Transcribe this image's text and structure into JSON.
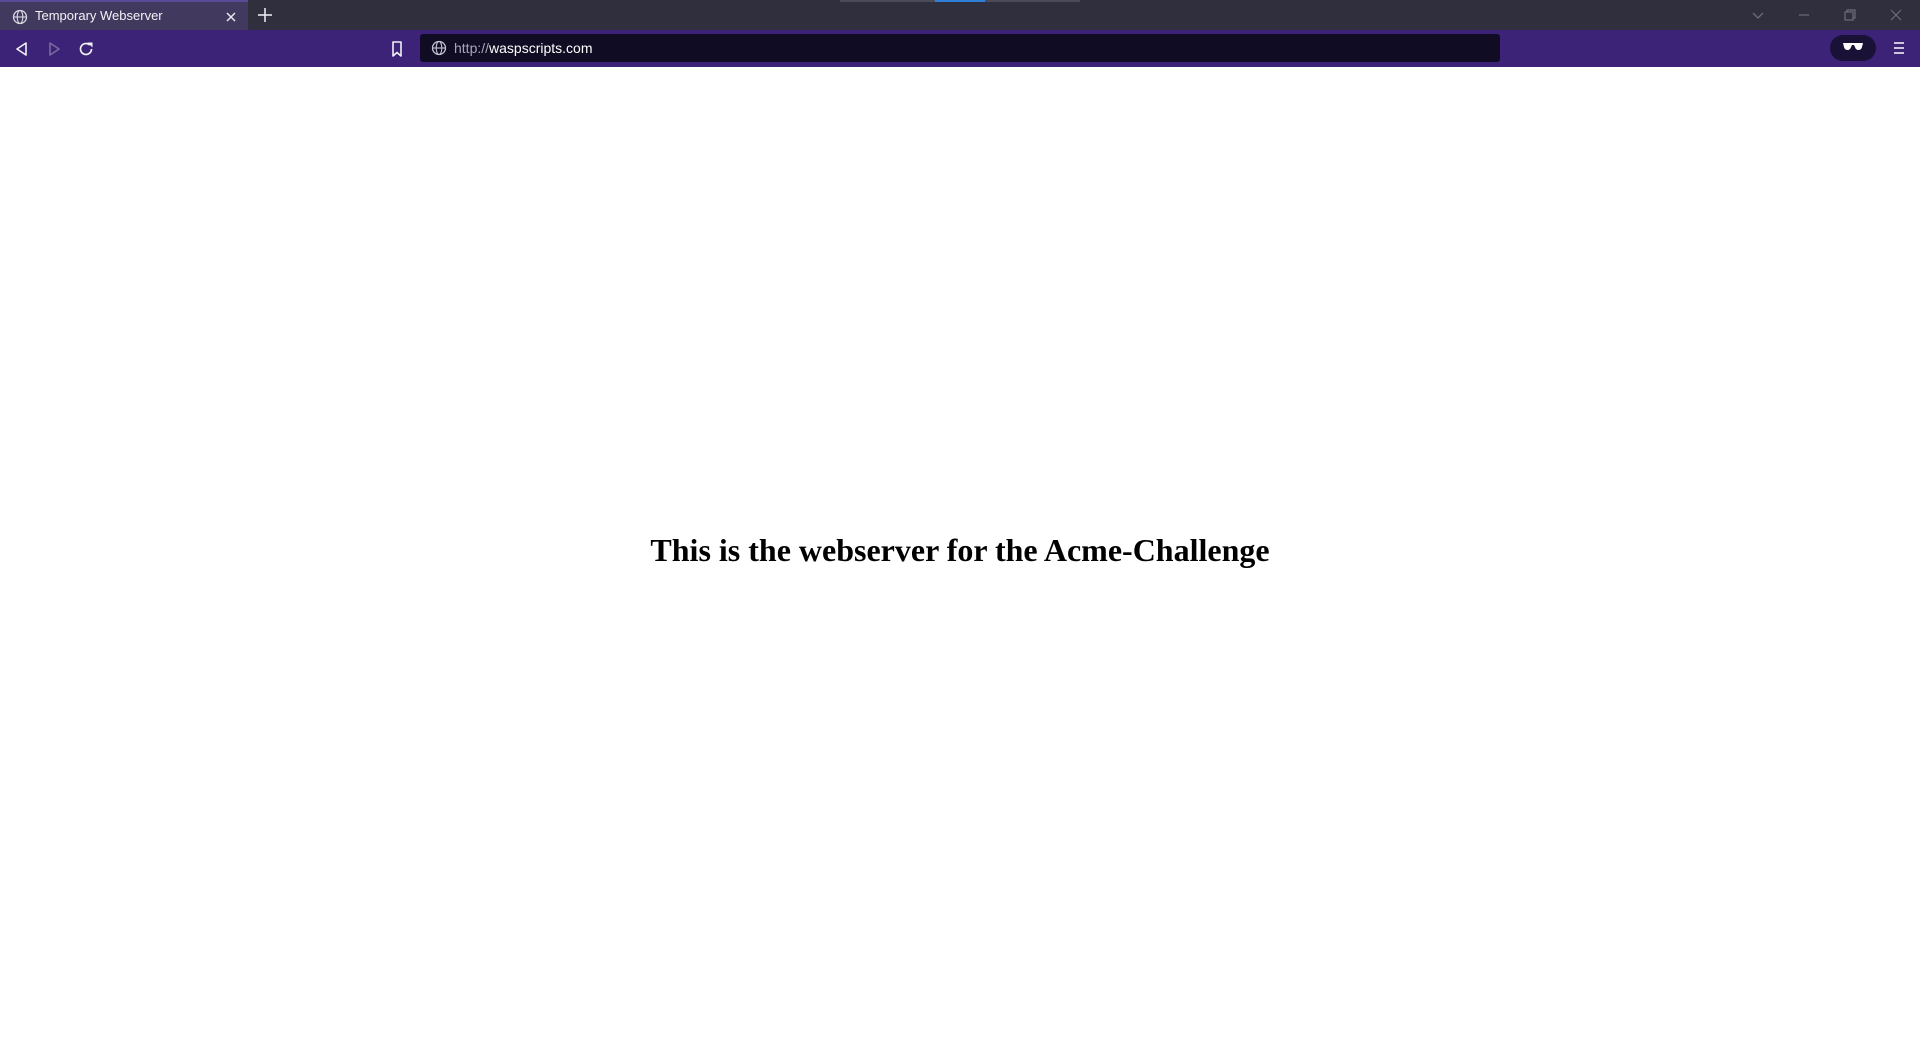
{
  "browser": {
    "tab": {
      "title": "Temporary Webserver",
      "icon": "globe-icon"
    },
    "address_bar": {
      "scheme": "http://",
      "host": "waspscripts.com"
    },
    "colors": {
      "tab_strip": "#302f3d",
      "active_tab": "#42395f",
      "toolbar": "#3c2378",
      "url_field": "#0f0c24",
      "drag_indicator_active": "#2f7fd8"
    },
    "icons": {
      "back": "back-arrow-icon",
      "forward": "forward-arrow-icon",
      "reload": "reload-icon",
      "bookmark": "bookmark-icon",
      "site_info": "globe-icon",
      "private_mode": "private-glasses-icon",
      "menu": "hamburger-menu-icon",
      "new_tab": "plus-icon",
      "tab_list": "chevron-down-icon",
      "minimize": "minimize-icon",
      "restore": "restore-icon",
      "close_window": "close-icon"
    }
  },
  "page": {
    "heading": "This is the webserver for the Acme-Challenge"
  }
}
